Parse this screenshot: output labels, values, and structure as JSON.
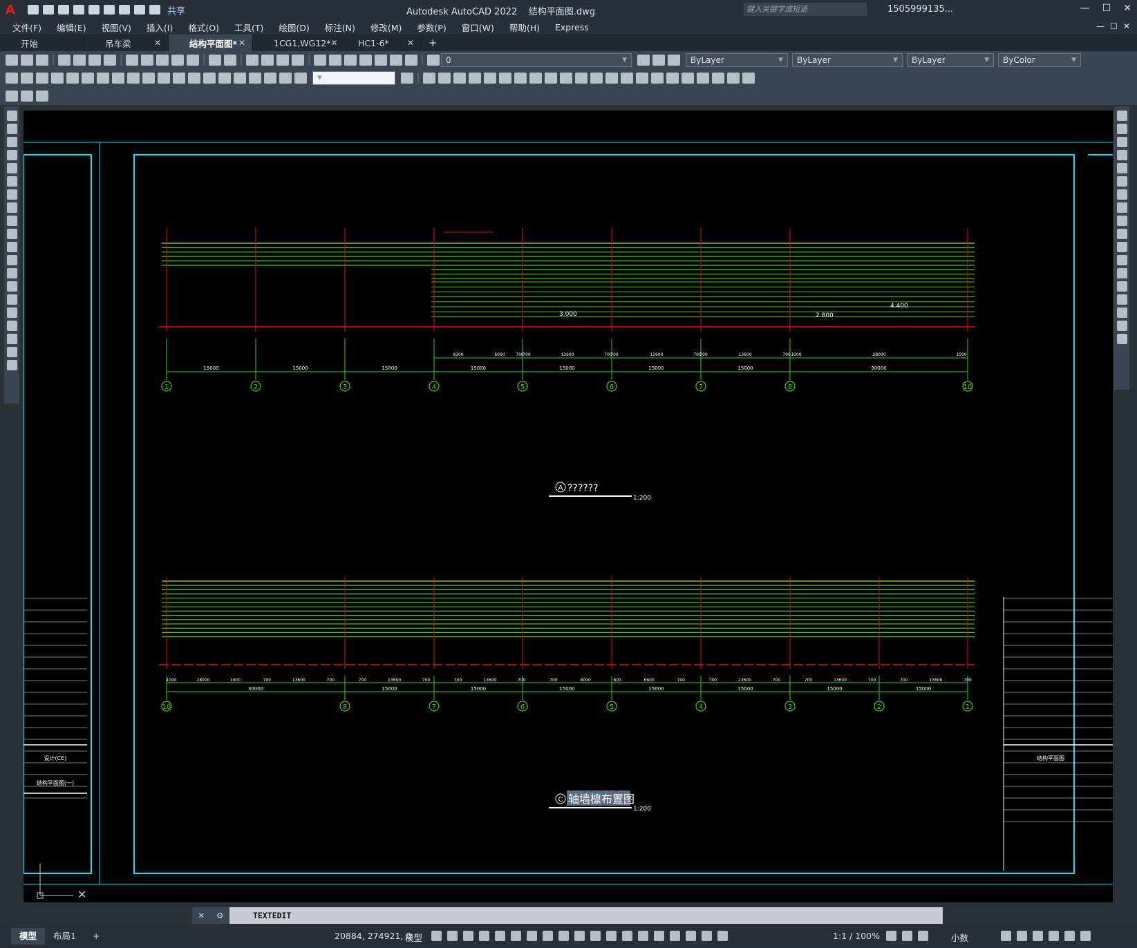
{
  "app": {
    "logo": "A",
    "title": "Autodesk AutoCAD 2022    结构平面图.dwg",
    "share_label": "共享",
    "search_placeholder": "键入关键字或短语",
    "user": "1505999135...",
    "win_min": "—",
    "win_max": "☐",
    "win_close": "✕"
  },
  "menu": [
    "文件(F)",
    "编辑(E)",
    "视图(V)",
    "插入(I)",
    "格式(O)",
    "工具(T)",
    "绘图(D)",
    "标注(N)",
    "修改(M)",
    "参数(P)",
    "窗口(W)",
    "帮助(H)",
    "Express"
  ],
  "tabs": [
    {
      "label": "开始",
      "active": false,
      "closable": false
    },
    {
      "label": "吊车梁",
      "active": false,
      "closable": true
    },
    {
      "label": "结构平面图*",
      "active": true,
      "closable": true
    },
    {
      "label": "1CG1,WG12*",
      "active": false,
      "closable": true
    },
    {
      "label": "HC1-6*",
      "active": false,
      "closable": true
    }
  ],
  "new_tab": "+",
  "properties": {
    "layer": "0",
    "color": "ByLayer",
    "linetype": "ByLayer",
    "lineweight": "ByLayer",
    "plotstyle": "ByColor"
  },
  "drawing": {
    "view1_label": "A",
    "view1_title": "??????",
    "view1_scale": "1:200",
    "view2_label": "C",
    "view2_title": "轴墙檩布置图",
    "view2_scale": "1:200",
    "top_axes": [
      "1",
      "2",
      "3",
      "4",
      "5",
      "6",
      "7",
      "8",
      "10"
    ],
    "top_dims_lower": [
      "15000",
      "15000",
      "15000",
      "15000",
      "15000",
      "15000",
      "15000",
      "30000"
    ],
    "top_dims_upper": [
      "8300",
      "6000",
      "700",
      "700",
      "13600",
      "700",
      "700",
      "13600",
      "700",
      "700",
      "13600",
      "700",
      "1000",
      "28000",
      "1000"
    ],
    "top_elev_notes": [
      "3.000",
      "2.800",
      "4.400"
    ],
    "bottom_axes": [
      "10",
      "8",
      "7",
      "6",
      "5",
      "4",
      "3",
      "2",
      "1"
    ],
    "bottom_dims_lower": [
      "30000",
      "15000",
      "15000",
      "15000",
      "15000",
      "15000",
      "15000",
      "15000"
    ],
    "bottom_dims_upper": [
      "1000",
      "28000",
      "1000",
      "700",
      "13600",
      "700",
      "700",
      "13600",
      "700",
      "700",
      "13600",
      "700",
      "700",
      "8000",
      "600",
      "6600",
      "700",
      "700",
      "13600",
      "700",
      "700",
      "13600",
      "700",
      "700",
      "13600",
      "700"
    ],
    "title_block_left": [
      "设计(CE)",
      "结构平面图(一)"
    ],
    "title_block_right": [
      "结构平面图"
    ]
  },
  "command": {
    "text": "TEXTEDIT"
  },
  "status": {
    "layout_tabs": [
      "模型",
      "布局1"
    ],
    "add_layout": "+",
    "coords": "20884, 274921, 0",
    "space": "模型",
    "scale": "1:1 / 100%",
    "units": "小数"
  }
}
